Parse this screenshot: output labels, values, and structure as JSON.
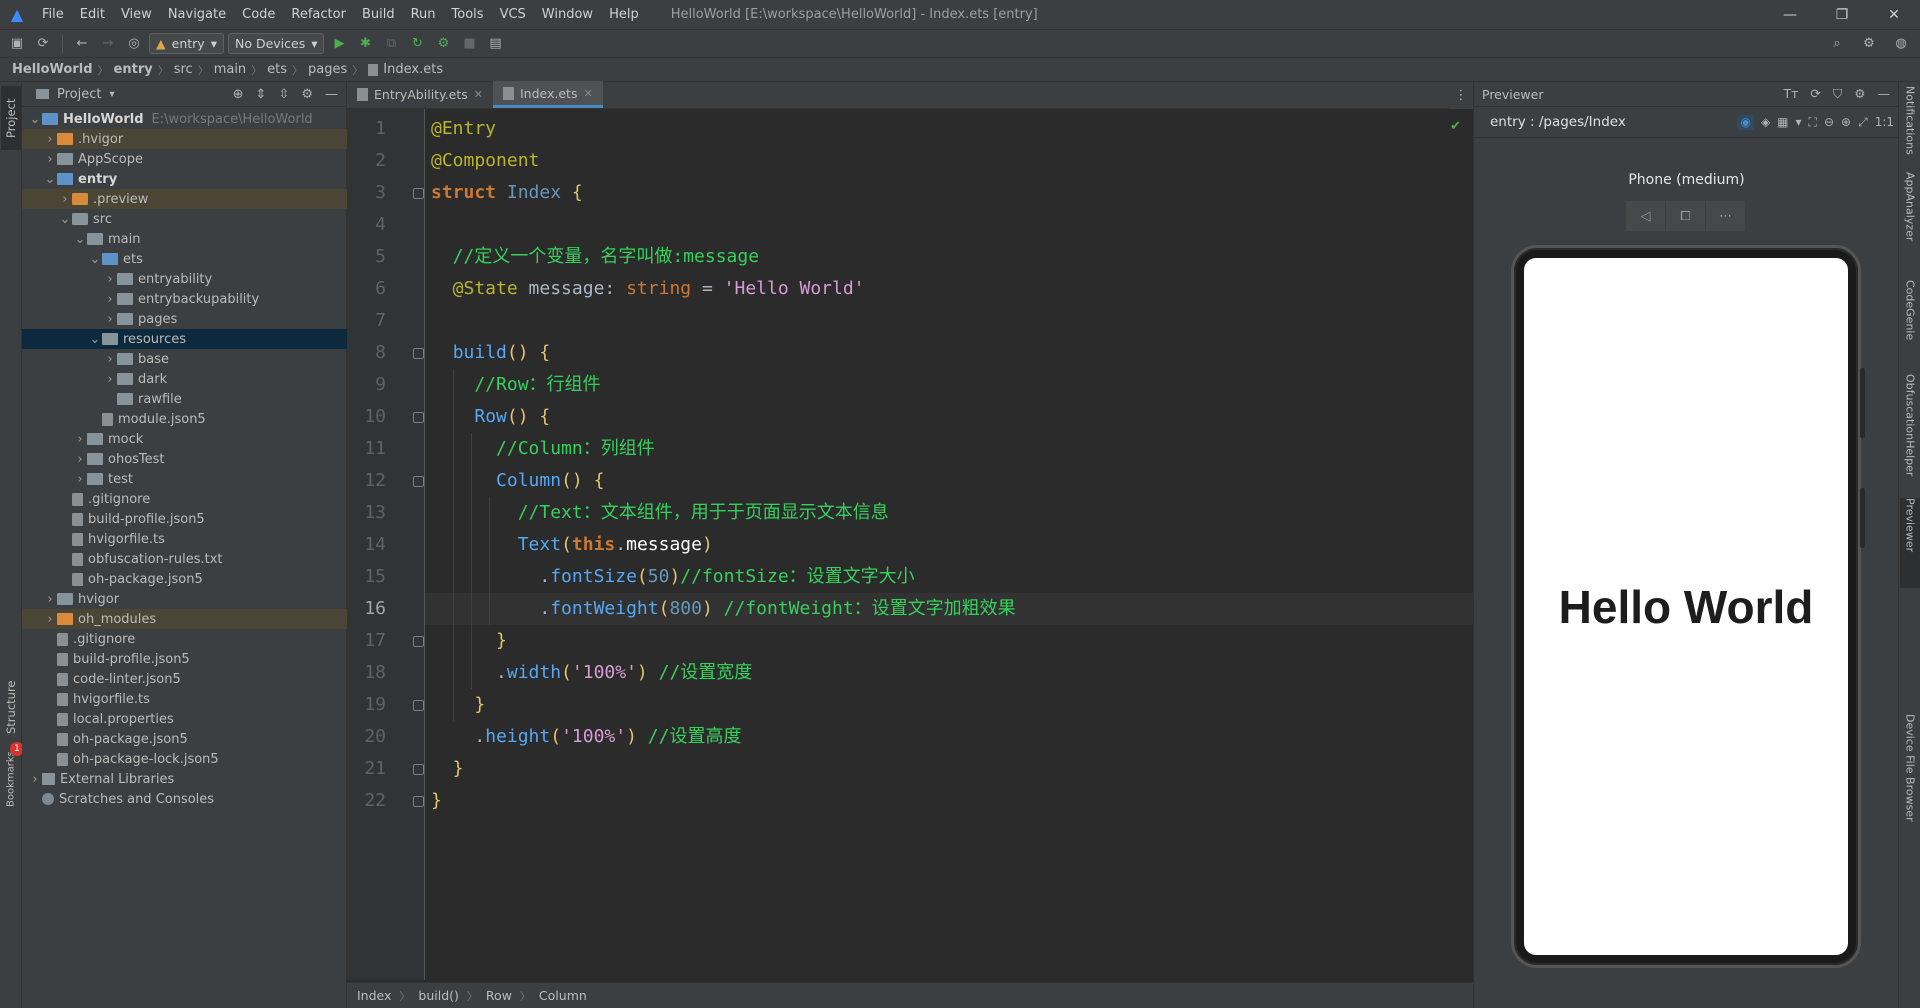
{
  "window": {
    "title": "HelloWorld [E:\\workspace\\HelloWorld] - Index.ets [entry]",
    "menu": [
      "File",
      "Edit",
      "View",
      "Navigate",
      "Code",
      "Refactor",
      "Build",
      "Run",
      "Tools",
      "VCS",
      "Window",
      "Help"
    ]
  },
  "toolbar": {
    "module_select": "entry",
    "device_select": "No Devices"
  },
  "breadcrumb": [
    "HelloWorld",
    "entry",
    "src",
    "main",
    "ets",
    "pages",
    "Index.ets"
  ],
  "left_strip": {
    "project_tab": "Project",
    "structure_tab": "Structure",
    "bookmarks_tab": "Bookmarks",
    "badge": "1"
  },
  "project_panel": {
    "title": "Project",
    "tree": [
      {
        "label": "HelloWorld",
        "path": "E:\\workspace\\HelloWorld",
        "depth": 0,
        "expanded": true,
        "kind": "folder-blue",
        "bold": true
      },
      {
        "label": ".hvigor",
        "depth": 1,
        "expanded": false,
        "kind": "folder-orange",
        "hl": true
      },
      {
        "label": "AppScope",
        "depth": 1,
        "expanded": false,
        "kind": "folder"
      },
      {
        "label": "entry",
        "depth": 1,
        "expanded": true,
        "kind": "folder-blue",
        "bold": true
      },
      {
        "label": ".preview",
        "depth": 2,
        "expanded": false,
        "kind": "folder-orange",
        "hl": true
      },
      {
        "label": "src",
        "depth": 2,
        "expanded": true,
        "kind": "folder"
      },
      {
        "label": "main",
        "depth": 3,
        "expanded": true,
        "kind": "folder"
      },
      {
        "label": "ets",
        "depth": 4,
        "expanded": true,
        "kind": "folder-blue"
      },
      {
        "label": "entryability",
        "depth": 5,
        "expanded": false,
        "kind": "folder"
      },
      {
        "label": "entrybackupability",
        "depth": 5,
        "expanded": false,
        "kind": "folder"
      },
      {
        "label": "pages",
        "depth": 5,
        "expanded": false,
        "kind": "folder"
      },
      {
        "label": "resources",
        "depth": 4,
        "expanded": true,
        "kind": "folder",
        "sel": true
      },
      {
        "label": "base",
        "depth": 5,
        "expanded": false,
        "kind": "folder"
      },
      {
        "label": "dark",
        "depth": 5,
        "expanded": false,
        "kind": "folder"
      },
      {
        "label": "rawfile",
        "depth": 5,
        "kind": "folder"
      },
      {
        "label": "module.json5",
        "depth": 4,
        "kind": "file"
      },
      {
        "label": "mock",
        "depth": 3,
        "expanded": false,
        "kind": "folder"
      },
      {
        "label": "ohosTest",
        "depth": 3,
        "expanded": false,
        "kind": "folder"
      },
      {
        "label": "test",
        "depth": 3,
        "expanded": false,
        "kind": "folder"
      },
      {
        "label": ".gitignore",
        "depth": 2,
        "kind": "file"
      },
      {
        "label": "build-profile.json5",
        "depth": 2,
        "kind": "file"
      },
      {
        "label": "hvigorfile.ts",
        "depth": 2,
        "kind": "file"
      },
      {
        "label": "obfuscation-rules.txt",
        "depth": 2,
        "kind": "file"
      },
      {
        "label": "oh-package.json5",
        "depth": 2,
        "kind": "file"
      },
      {
        "label": "hvigor",
        "depth": 1,
        "expanded": false,
        "kind": "folder"
      },
      {
        "label": "oh_modules",
        "depth": 1,
        "expanded": false,
        "kind": "folder-orange",
        "hl": true
      },
      {
        "label": ".gitignore",
        "depth": 1,
        "kind": "file"
      },
      {
        "label": "build-profile.json5",
        "depth": 1,
        "kind": "file"
      },
      {
        "label": "code-linter.json5",
        "depth": 1,
        "kind": "file"
      },
      {
        "label": "hvigorfile.ts",
        "depth": 1,
        "kind": "file"
      },
      {
        "label": "local.properties",
        "depth": 1,
        "kind": "file"
      },
      {
        "label": "oh-package.json5",
        "depth": 1,
        "kind": "file"
      },
      {
        "label": "oh-package-lock.json5",
        "depth": 1,
        "kind": "file"
      },
      {
        "label": "External Libraries",
        "depth": 0,
        "expanded": false,
        "kind": "lib"
      },
      {
        "label": "Scratches and Consoles",
        "depth": 0,
        "kind": "scratch"
      }
    ]
  },
  "editor": {
    "tabs": [
      {
        "label": "EntryAbility.ets",
        "active": false
      },
      {
        "label": "Index.ets",
        "active": true
      }
    ],
    "current_line": 16,
    "lines": [
      [
        [
          "@Entry",
          "k-ann"
        ]
      ],
      [
        [
          "@Component",
          "k-ann"
        ]
      ],
      [
        [
          "struct ",
          "k-kw"
        ],
        [
          "Index ",
          "k-ty"
        ],
        [
          "{",
          "k-br"
        ]
      ],
      [],
      [
        [
          "  //定义一个变量，名字叫做:message",
          "k-cm"
        ]
      ],
      [
        [
          "  @State ",
          "k-ann"
        ],
        [
          "message",
          "k-id"
        ],
        [
          ": ",
          "k-id"
        ],
        [
          "string ",
          "k-kwp"
        ],
        [
          "= ",
          "k-id"
        ],
        [
          "'Hello World'",
          "k-strp"
        ]
      ],
      [],
      [
        [
          "  ",
          "k-id"
        ],
        [
          "build",
          "k-fn"
        ],
        [
          "() ",
          "k-br"
        ],
        [
          "{",
          "k-br"
        ]
      ],
      [
        [
          "    //Row：行组件",
          "k-cm"
        ]
      ],
      [
        [
          "    ",
          "k-id"
        ],
        [
          "Row",
          "k-fn"
        ],
        [
          "() ",
          "k-br"
        ],
        [
          "{",
          "k-br"
        ]
      ],
      [
        [
          "      //Column：列组件",
          "k-cm"
        ]
      ],
      [
        [
          "      ",
          "k-id"
        ],
        [
          "Column",
          "k-fn"
        ],
        [
          "() ",
          "k-br"
        ],
        [
          "{",
          "k-br"
        ]
      ],
      [
        [
          "        //Text：文本组件，用于于页面显示文本信息",
          "k-cm"
        ]
      ],
      [
        [
          "        ",
          "k-id"
        ],
        [
          "Text",
          "k-fn"
        ],
        [
          "(",
          "k-br"
        ],
        [
          "this",
          "k-kw"
        ],
        [
          ".",
          "k-dot"
        ],
        [
          "message",
          "k-white"
        ],
        [
          ")",
          "k-br"
        ]
      ],
      [
        [
          "          .",
          "k-dot"
        ],
        [
          "fontSize",
          "k-fn"
        ],
        [
          "(",
          "k-br"
        ],
        [
          "50",
          "k-num"
        ],
        [
          ")",
          "k-br"
        ],
        [
          "//fontSize：设置文字大小",
          "k-cm"
        ]
      ],
      [
        [
          "          .",
          "k-dot"
        ],
        [
          "fontWeight",
          "k-fn"
        ],
        [
          "(",
          "k-br"
        ],
        [
          "800",
          "k-num"
        ],
        [
          ") ",
          "k-br"
        ],
        [
          "//fontWeight：设置文字加粗效果",
          "k-cm"
        ]
      ],
      [
        [
          "      }",
          "k-br"
        ]
      ],
      [
        [
          "      .",
          "k-dot"
        ],
        [
          "width",
          "k-fn"
        ],
        [
          "(",
          "k-br"
        ],
        [
          "'100%'",
          "k-strp"
        ],
        [
          ") ",
          "k-br"
        ],
        [
          "//设置宽度",
          "k-cm"
        ]
      ],
      [
        [
          "    }",
          "k-br"
        ]
      ],
      [
        [
          "    .",
          "k-dot"
        ],
        [
          "height",
          "k-fn"
        ],
        [
          "(",
          "k-br"
        ],
        [
          "'100%'",
          "k-strp"
        ],
        [
          ") ",
          "k-br"
        ],
        [
          "//设置高度",
          "k-cm"
        ]
      ],
      [
        [
          "  }",
          "k-br"
        ]
      ],
      [
        [
          "}",
          "k-br"
        ]
      ]
    ]
  },
  "status_breadcrumb": [
    "Index",
    "build()",
    "Row",
    "Column"
  ],
  "previewer": {
    "title": "Previewer",
    "route": "entry : /pages/Index",
    "device": "Phone (medium)",
    "screen_text": "Hello World"
  },
  "right_strip": [
    "Notifications",
    "AppAnalyzer",
    "CodeGenie",
    "ObfuscationHelper",
    "Previewer",
    "Device File Browser"
  ]
}
